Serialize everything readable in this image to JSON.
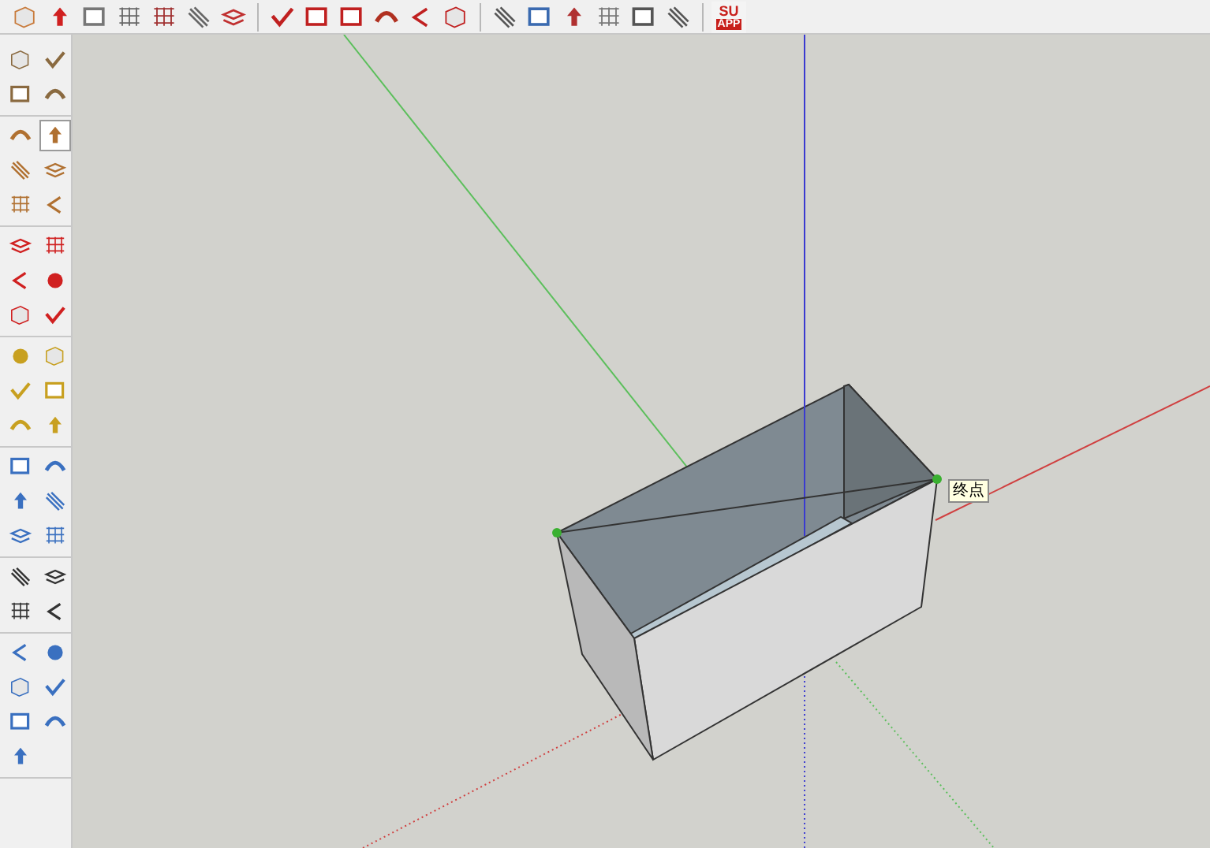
{
  "toolbar": {
    "logo": {
      "top": "SU",
      "bottom": "APP"
    }
  },
  "tool_palette": {
    "groups": [
      [
        {
          "selected": false
        },
        {
          "selected": false
        },
        {
          "selected": false
        },
        {
          "selected": false
        }
      ],
      [
        {
          "selected": false
        },
        {
          "selected": true
        },
        {
          "selected": false
        },
        {
          "selected": false
        },
        {
          "selected": false
        },
        {
          "selected": false
        }
      ],
      [
        {
          "selected": false
        },
        {
          "selected": false
        },
        {
          "selected": false
        },
        {
          "selected": false
        },
        {
          "selected": false
        },
        {
          "selected": false
        }
      ],
      [
        {
          "selected": false
        },
        {
          "selected": false
        },
        {
          "selected": false
        },
        {
          "selected": false
        },
        {
          "selected": false
        },
        {
          "selected": false
        }
      ],
      [
        {
          "selected": false
        },
        {
          "selected": false
        },
        {
          "selected": false
        },
        {
          "selected": false
        },
        {
          "selected": false
        },
        {
          "selected": false
        }
      ],
      [
        {
          "selected": false
        },
        {
          "selected": false
        },
        {
          "selected": false
        },
        {
          "selected": false
        }
      ],
      [
        {
          "selected": false
        },
        {
          "selected": false
        },
        {
          "selected": false
        },
        {
          "selected": false
        },
        {
          "selected": false
        },
        {
          "selected": false
        },
        {
          "selected": false
        }
      ]
    ]
  },
  "viewport": {
    "tooltip": "终点"
  }
}
